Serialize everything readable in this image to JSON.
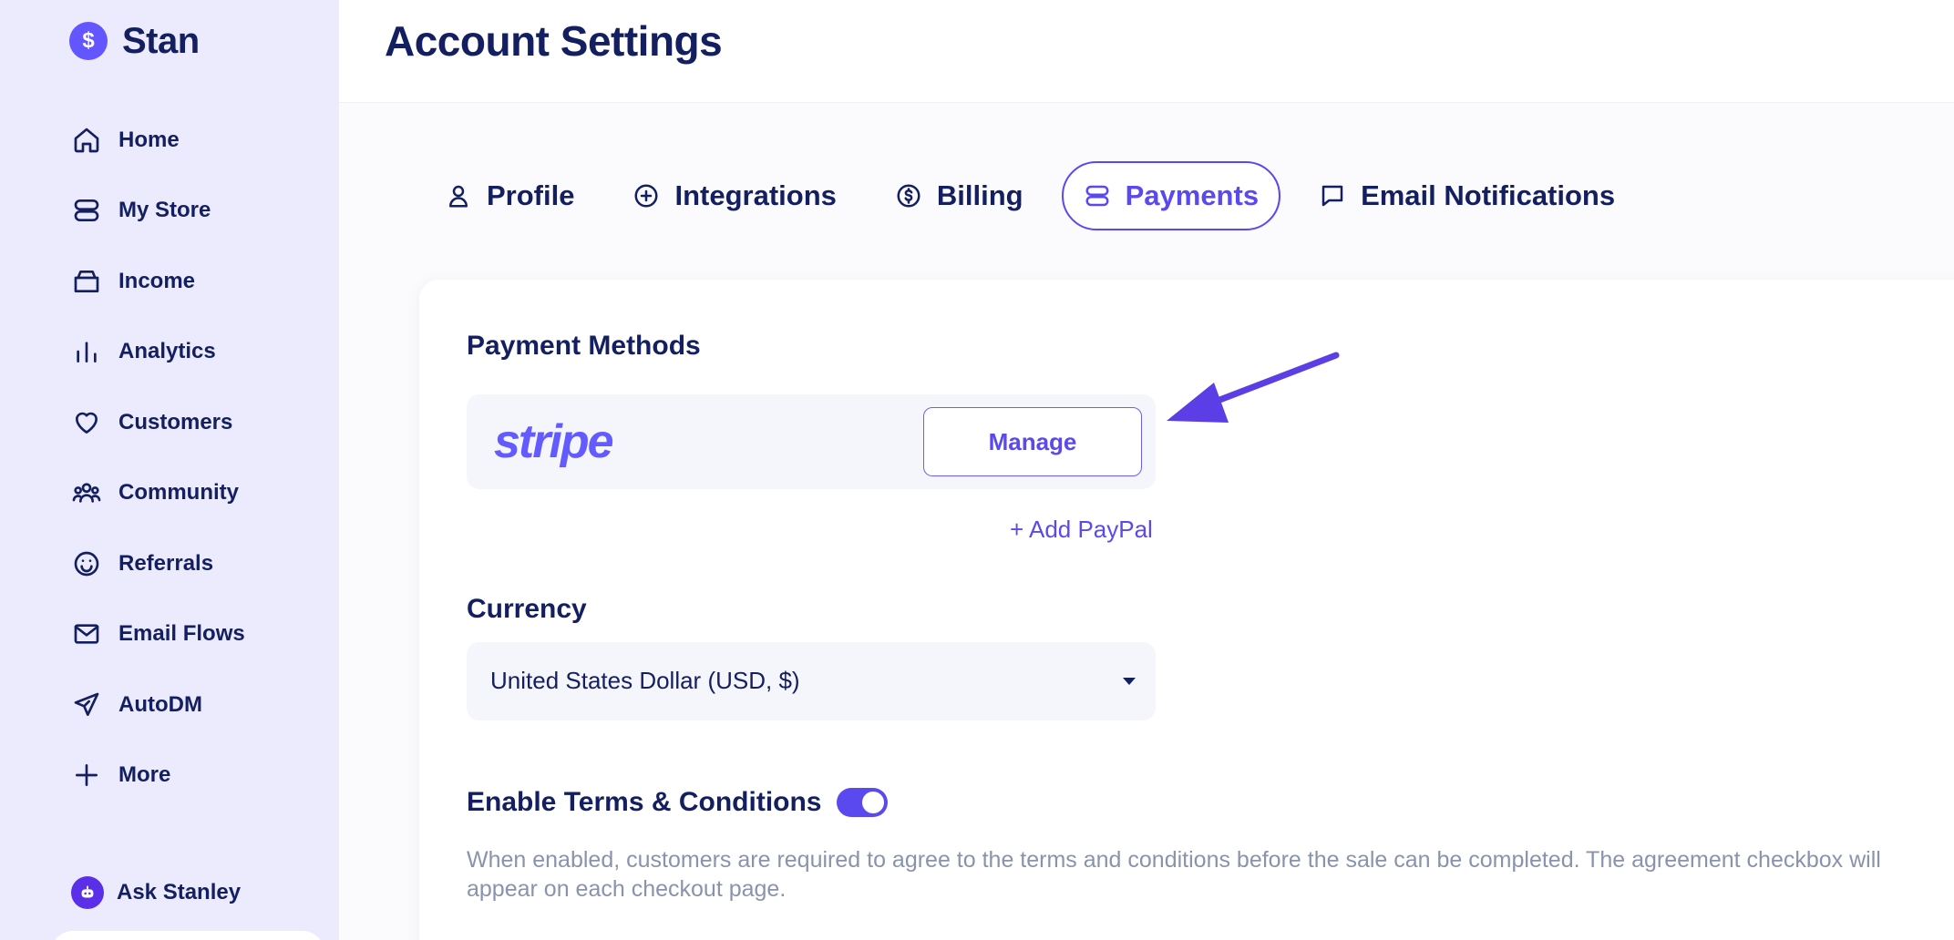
{
  "app": {
    "name": "Stan"
  },
  "sidebar": {
    "items": [
      {
        "label": "Home",
        "icon": "home-icon"
      },
      {
        "label": "My Store",
        "icon": "store-icon"
      },
      {
        "label": "Income",
        "icon": "wallet-icon"
      },
      {
        "label": "Analytics",
        "icon": "analytics-icon"
      },
      {
        "label": "Customers",
        "icon": "heart-icon"
      },
      {
        "label": "Community",
        "icon": "community-icon"
      },
      {
        "label": "Referrals",
        "icon": "smile-icon"
      },
      {
        "label": "Email Flows",
        "icon": "mail-icon"
      },
      {
        "label": "AutoDM",
        "icon": "send-icon"
      },
      {
        "label": "More",
        "icon": "plus-icon"
      }
    ],
    "ask_label": "Ask Stanley"
  },
  "header": {
    "title": "Account Settings"
  },
  "tabs": [
    {
      "label": "Profile",
      "icon": "user-icon"
    },
    {
      "label": "Integrations",
      "icon": "plus-circle-icon"
    },
    {
      "label": "Billing",
      "icon": "dollar-circle-icon"
    },
    {
      "label": "Payments",
      "icon": "payments-icon",
      "active": true
    },
    {
      "label": "Email Notifications",
      "icon": "message-icon"
    }
  ],
  "payments": {
    "methods_title": "Payment Methods",
    "stripe_logo": "stripe",
    "manage_label": "Manage",
    "add_paypal_label": "+ Add PayPal",
    "currency_title": "Currency",
    "currency_value": "United States Dollar (USD, $)",
    "terms_title": "Enable Terms & Conditions",
    "terms_enabled": true,
    "terms_description": "When enabled, customers are required to agree to the terms and conditions before the sale can be completed. The agreement checkbox will appear on each checkout page."
  },
  "colors": {
    "accent": "#5b49f0",
    "sidebar_bg": "#ecebfd",
    "text": "#131f60",
    "stripe": "#635bff"
  }
}
